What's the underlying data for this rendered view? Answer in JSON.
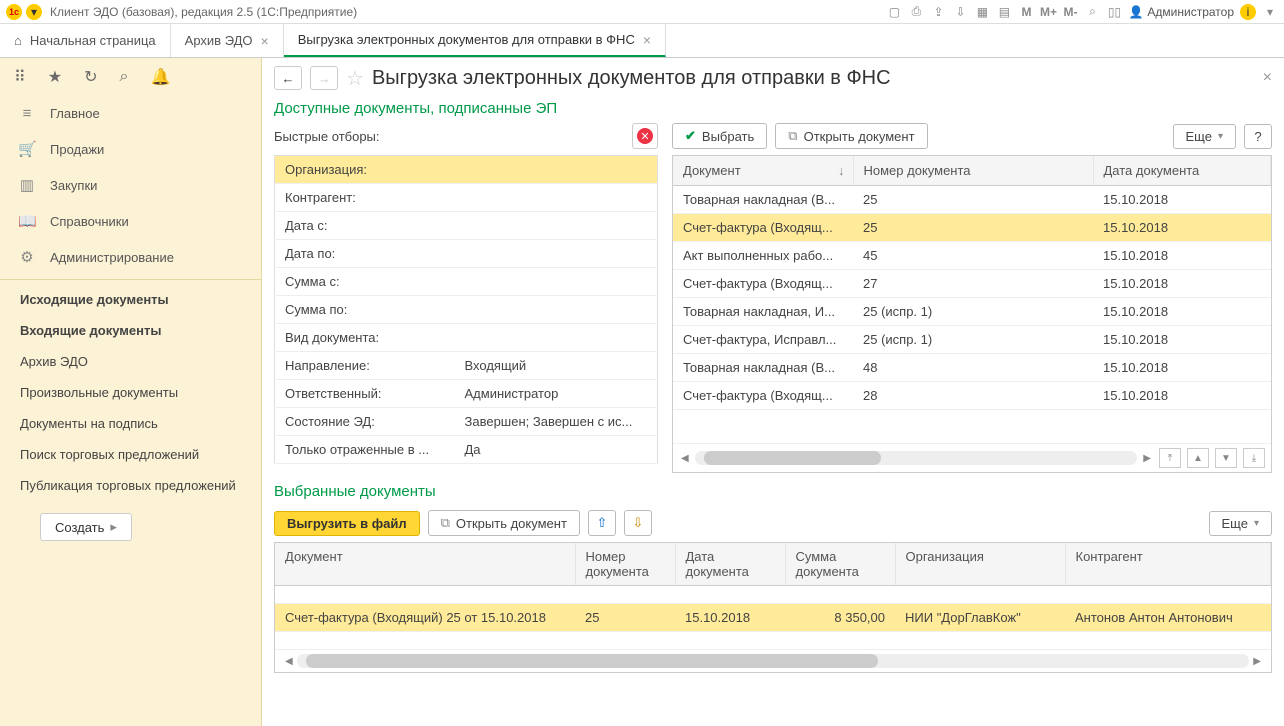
{
  "sysbar": {
    "title": "Клиент ЭДО (базовая), редакция 2.5  (1С:Предприятие)",
    "user": "Администратор",
    "m_labels": [
      "M",
      "M+",
      "M-"
    ]
  },
  "tabs": {
    "home": "Начальная страница",
    "archive": "Архив ЭДО",
    "export": "Выгрузка электронных документов для отправки в ФНС"
  },
  "leftnav": {
    "main": "Главное",
    "sales": "Продажи",
    "purchases": "Закупки",
    "refs": "Справочники",
    "admin": "Администрирование",
    "out": "Исходящие документы",
    "in": "Входящие документы",
    "archive": "Архив ЭДО",
    "arbitrary": "Произвольные документы",
    "tosign": "Документы на подпись",
    "searchoffers": "Поиск торговых предложений",
    "puboffers": "Публикация торговых предложений",
    "create": "Создать"
  },
  "header": {
    "title": "Выгрузка электронных документов для отправки в ФНС"
  },
  "avail": {
    "title": "Доступные документы, подписанные ЭП",
    "quick": "Быстрые отборы:",
    "filters": [
      {
        "k": "Организация:",
        "v": ""
      },
      {
        "k": "Контрагент:",
        "v": ""
      },
      {
        "k": "Дата с:",
        "v": ""
      },
      {
        "k": "Дата по:",
        "v": ""
      },
      {
        "k": "Сумма с:",
        "v": ""
      },
      {
        "k": "Сумма по:",
        "v": ""
      },
      {
        "k": "Вид документа:",
        "v": ""
      },
      {
        "k": "Направление:",
        "v": "Входящий"
      },
      {
        "k": "Ответственный:",
        "v": "Администратор"
      },
      {
        "k": "Состояние ЭД:",
        "v": "Завершен; Завершен с ис..."
      },
      {
        "k": "Только отраженные в ...",
        "v": "Да"
      }
    ],
    "toolbar": {
      "select": "Выбрать",
      "open": "Открыть документ",
      "more": "Еще"
    },
    "cols": {
      "doc": "Документ",
      "num": "Номер документа",
      "date": "Дата документа"
    },
    "rows": [
      {
        "doc": "Товарная накладная (В...",
        "num": "25",
        "date": "15.10.2018"
      },
      {
        "doc": "Счет-фактура (Входящ...",
        "num": "25",
        "date": "15.10.2018"
      },
      {
        "doc": "Акт выполненных рабо...",
        "num": "45",
        "date": "15.10.2018"
      },
      {
        "doc": "Счет-фактура (Входящ...",
        "num": "27",
        "date": "15.10.2018"
      },
      {
        "doc": "Товарная накладная, И...",
        "num": "25 (испр. 1)",
        "date": "15.10.2018"
      },
      {
        "doc": "Счет-фактура, Исправл...",
        "num": "25 (испр. 1)",
        "date": "15.10.2018"
      },
      {
        "doc": "Товарная накладная (В...",
        "num": "48",
        "date": "15.10.2018"
      },
      {
        "doc": "Счет-фактура (Входящ...",
        "num": "28",
        "date": "15.10.2018"
      }
    ]
  },
  "selected": {
    "title": "Выбранные документы",
    "toolbar": {
      "export": "Выгрузить в файл",
      "open": "Открыть документ",
      "more": "Еще"
    },
    "cols": {
      "doc": "Документ",
      "num": "Номер документа",
      "date": "Дата документа",
      "sum": "Сумма документа",
      "org": "Организация",
      "contr": "Контрагент"
    },
    "rows": [
      {
        "doc": "Счет-фактура (Входящий) 25 от 15.10.2018",
        "num": "25",
        "date": "15.10.2018",
        "sum": "8 350,00",
        "org": "НИИ \"ДорГлавКож\"",
        "contr": "Антонов Антон Антонович"
      }
    ]
  }
}
